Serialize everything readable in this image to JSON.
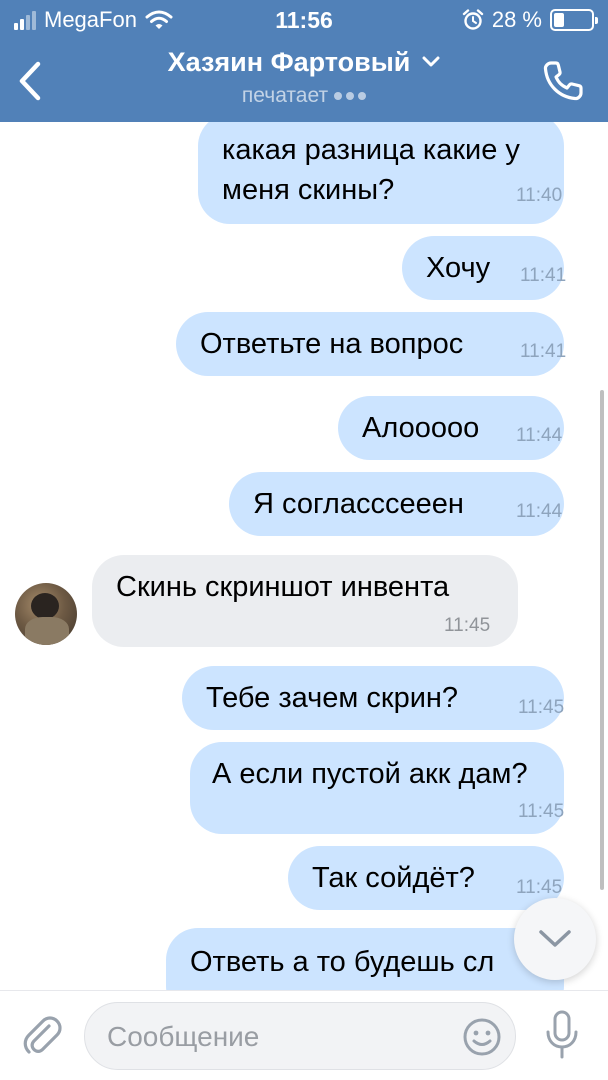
{
  "status_bar": {
    "carrier": "MegaFon",
    "time": "11:56",
    "battery_percent": "28 %",
    "battery_level": 0.28,
    "signal_bars_filled": 2,
    "signal_bars_total": 4,
    "icons": [
      "signal-icon",
      "wifi-icon",
      "alarm-icon",
      "battery-icon"
    ]
  },
  "header": {
    "back_icon": "back-arrow-icon",
    "title": "Хазяин Фартовый",
    "title_icon": "chevron-down-icon",
    "subtitle": "печатает",
    "call_icon": "phone-icon",
    "background": "#5181b8"
  },
  "messages": [
    {
      "direction": "out",
      "text_lines": [
        "какая разница какие у",
        "меня скины?"
      ],
      "time": "11:40"
    },
    {
      "direction": "out",
      "text_lines": [
        "Хочу"
      ],
      "time": "11:41"
    },
    {
      "direction": "out",
      "text_lines": [
        "Ответьте на вопрос"
      ],
      "time": "11:41"
    },
    {
      "direction": "out",
      "text_lines": [
        "Алооооо"
      ],
      "time": "11:44"
    },
    {
      "direction": "out",
      "text_lines": [
        "Я согласссееен"
      ],
      "time": "11:44"
    },
    {
      "direction": "in",
      "text_lines": [
        "Скинь скриншот инвента"
      ],
      "time": "11:45"
    },
    {
      "direction": "out",
      "text_lines": [
        "Тебе зачем скрин?"
      ],
      "time": "11:45"
    },
    {
      "direction": "out",
      "text_lines": [
        "А если пустой акк дам?"
      ],
      "time": "11:45"
    },
    {
      "direction": "out",
      "text_lines": [
        "Так сойдёт?"
      ],
      "time": "11:45"
    },
    {
      "direction": "out",
      "text_lines": [
        "Ответь а то будешь сл"
      ],
      "time": ""
    }
  ],
  "colors": {
    "outgoing_bubble": "#cce4ff",
    "incoming_bubble": "#ebedf0",
    "accent": "#5181b8"
  },
  "scroll_down_icon": "chevron-down-icon",
  "composer": {
    "attach_icon": "paperclip-icon",
    "placeholder": "Сообщение",
    "emoji_icon": "smiley-icon",
    "mic_icon": "microphone-icon"
  }
}
